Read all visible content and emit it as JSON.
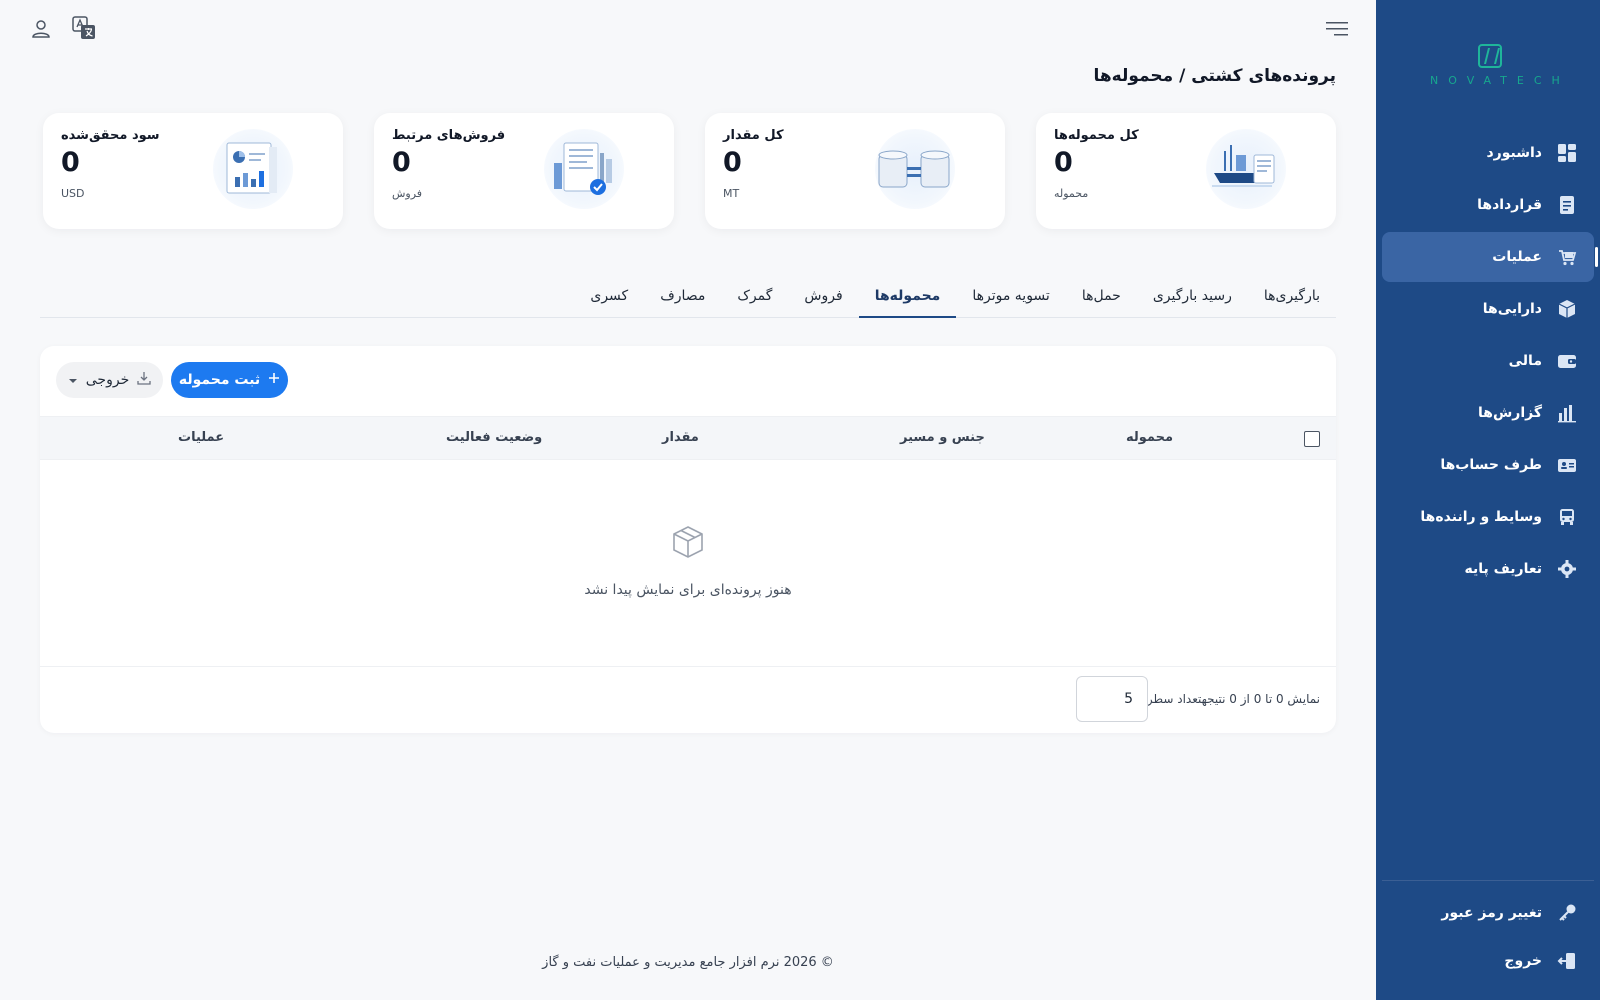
{
  "brand": {
    "logo_text": "NOVATECH",
    "accent": "#17a78e"
  },
  "colors": {
    "sidebar": "#1e4a86",
    "primary_button": "#1d7af0",
    "active_nav": "#3a65a4"
  },
  "sidebar": {
    "items": [
      {
        "label": "داشبورد",
        "icon": "dashboard-icon"
      },
      {
        "label": "قراردادها",
        "icon": "contract-icon"
      },
      {
        "label": "عملیات",
        "icon": "operations-icon",
        "active": true
      },
      {
        "label": "دارایی‌ها",
        "icon": "box-icon"
      },
      {
        "label": "مالی",
        "icon": "wallet-icon"
      },
      {
        "label": "گزارش‌ها",
        "icon": "bar-chart-icon"
      },
      {
        "label": "طرف حساب‌ها",
        "icon": "id-card-icon"
      },
      {
        "label": "وسایط و راننده‌ها",
        "icon": "bus-icon"
      },
      {
        "label": "تعاریف پایه",
        "icon": "gear-icon"
      }
    ],
    "bottom": [
      {
        "label": "تغییر رمز عبور",
        "icon": "key-icon"
      },
      {
        "label": "خروج",
        "icon": "logout-icon"
      }
    ]
  },
  "header": {
    "title": "پرونده‌های کشتی / محموله‌ها"
  },
  "cards": [
    {
      "label": "کل محموله‌ها",
      "value": "0",
      "unit": "محموله",
      "icon": "ship-illustration"
    },
    {
      "label": "کل مقدار",
      "value": "0",
      "unit": "MT",
      "icon": "tanks-illustration"
    },
    {
      "label": "فروش‌های مرتبط",
      "value": "0",
      "unit": "فروش",
      "icon": "document-check-illustration"
    },
    {
      "label": "سود محقق‌شده",
      "value": "0",
      "unit": "USD",
      "icon": "report-chart-illustration"
    }
  ],
  "tabs": [
    "بارگیری‌ها",
    "رسید بارگیری",
    "حمل‌ها",
    "تسویه موترها",
    "محموله‌ها",
    "فروش",
    "گمرک",
    "مصارف",
    "کسری"
  ],
  "active_tab": "محموله‌ها",
  "toolbar": {
    "add_label": "ثبت محموله",
    "export_label": "خروجی"
  },
  "table": {
    "columns": [
      "محموله",
      "جنس و مسیر",
      "مقدار",
      "وضعیت فعالیت",
      "عملیات"
    ],
    "rows": [],
    "empty_text": "هنوز پرونده‌ای برای نمایش پیدا نشد"
  },
  "pagination": {
    "summary": "نمایش 0 تا 0 از 0 نتیجه",
    "rows_label": "تعداد سطر:",
    "rows_value": "5"
  },
  "footer": {
    "text": "© 2026 نرم افزار جامع مدیریت و عملیات نفت و گاز"
  }
}
